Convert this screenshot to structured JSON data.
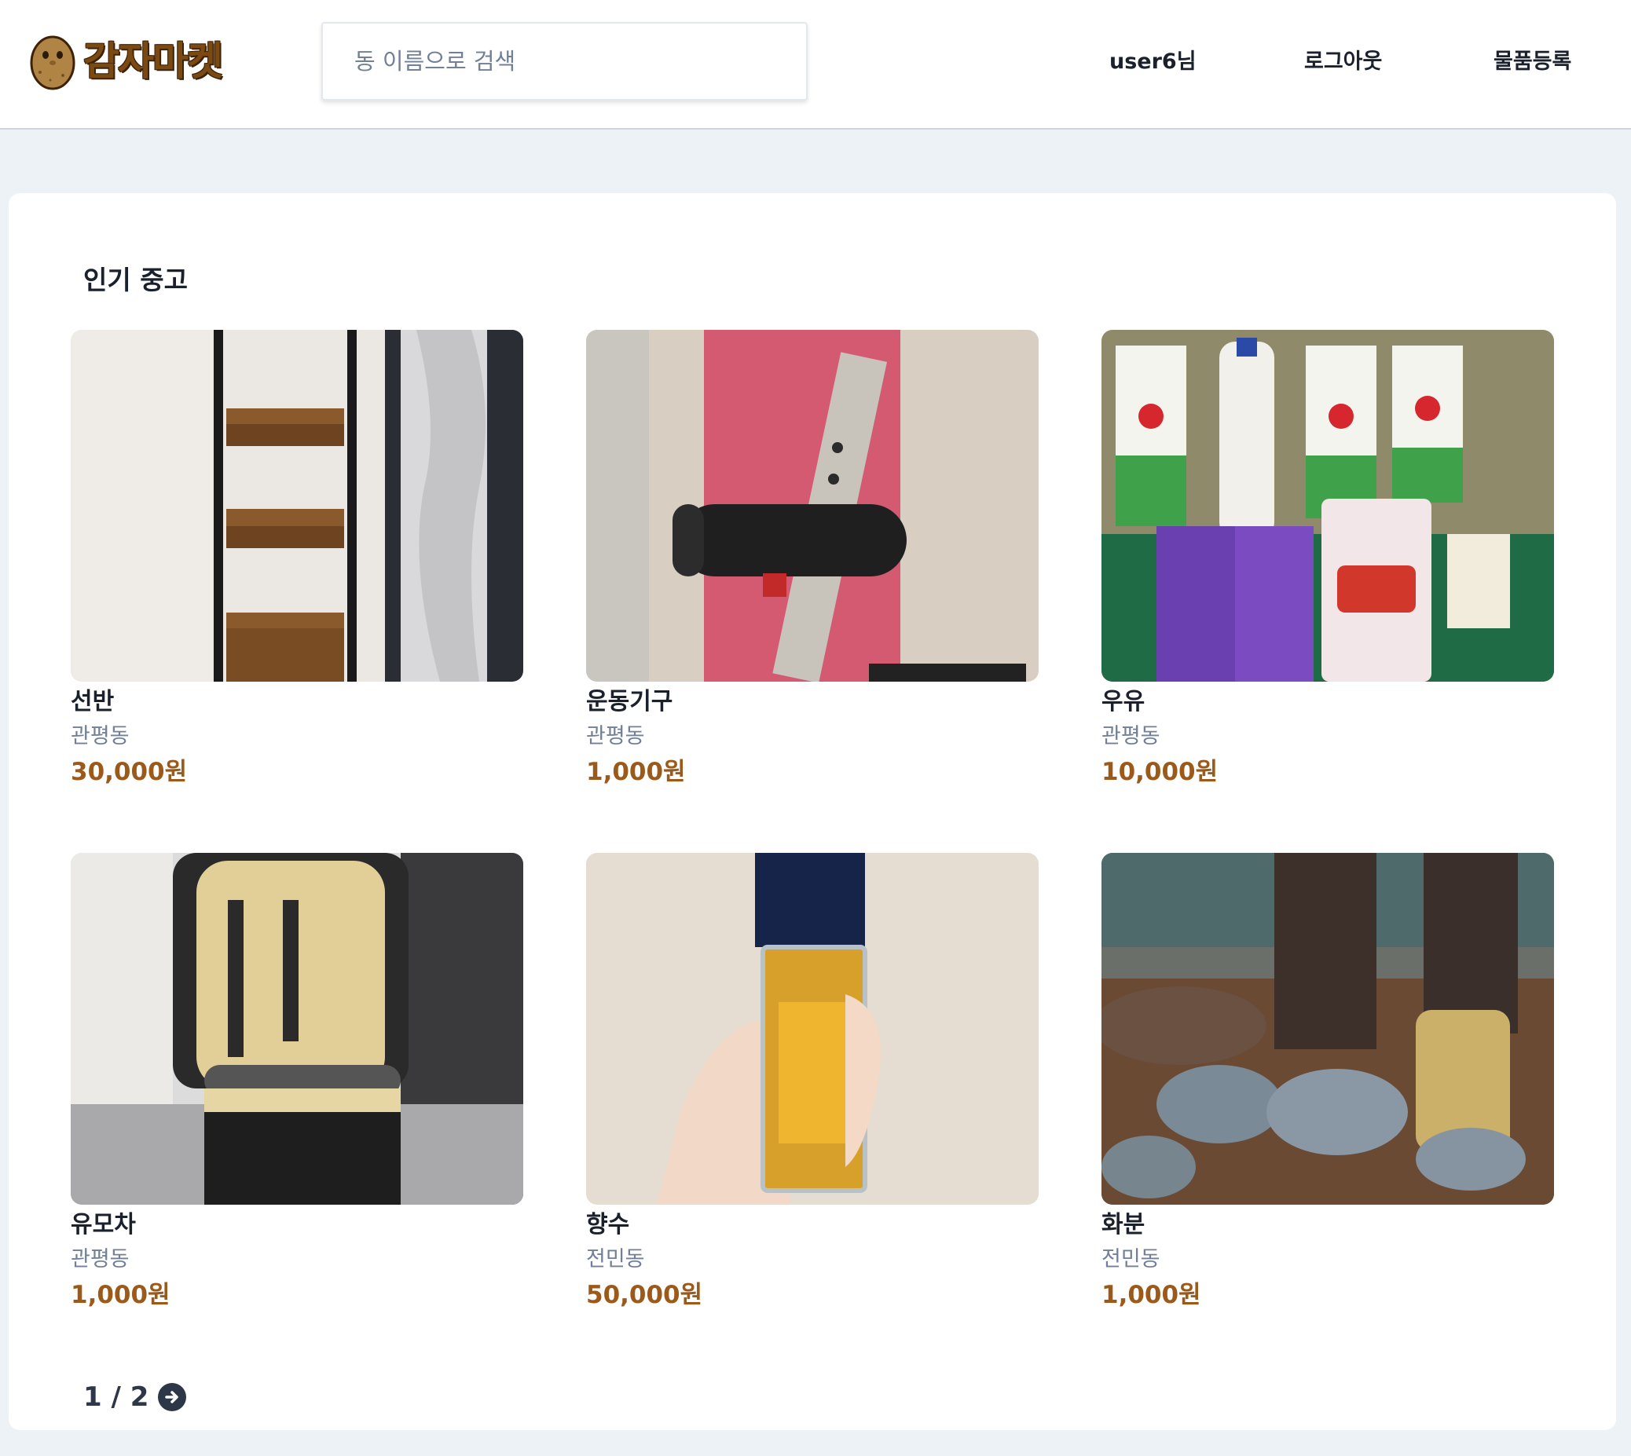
{
  "header": {
    "logo_text": "감자마켓",
    "search_placeholder": "동 이름으로 검색",
    "user_label": "user6님",
    "logout_label": "로그아웃",
    "register_label": "물품등록"
  },
  "section": {
    "title": "인기 중고"
  },
  "products": [
    {
      "title": "선반",
      "location": "관평동",
      "price": "30,000원"
    },
    {
      "title": "운동기구",
      "location": "관평동",
      "price": "1,000원"
    },
    {
      "title": "우유",
      "location": "관평동",
      "price": "10,000원"
    },
    {
      "title": "유모차",
      "location": "관평동",
      "price": "1,000원"
    },
    {
      "title": "향수",
      "location": "전민동",
      "price": "50,000원"
    },
    {
      "title": "화분",
      "location": "전민동",
      "price": "1,000원"
    }
  ],
  "pagination": {
    "label": "1 / 2",
    "next_icon": "arrow-right-circle-icon"
  },
  "colors": {
    "background": "#edf2f7",
    "price": "#9c5a1a",
    "logo": "#7b4a12"
  }
}
